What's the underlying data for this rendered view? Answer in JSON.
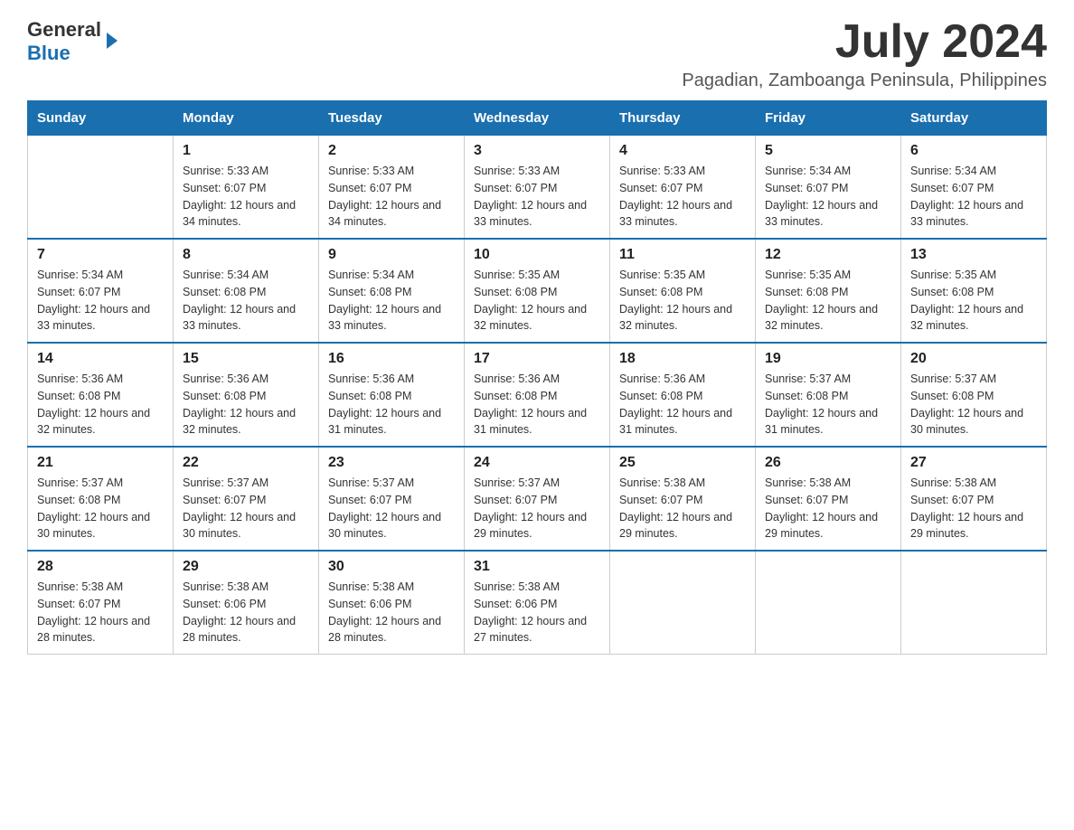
{
  "header": {
    "logo": {
      "text_general": "General",
      "text_blue": "Blue"
    },
    "title": "July 2024",
    "location": "Pagadian, Zamboanga Peninsula, Philippines"
  },
  "days_of_week": [
    "Sunday",
    "Monday",
    "Tuesday",
    "Wednesday",
    "Thursday",
    "Friday",
    "Saturday"
  ],
  "weeks": [
    [
      {
        "day": "",
        "sunrise": "",
        "sunset": "",
        "daylight": ""
      },
      {
        "day": "1",
        "sunrise": "Sunrise: 5:33 AM",
        "sunset": "Sunset: 6:07 PM",
        "daylight": "Daylight: 12 hours and 34 minutes."
      },
      {
        "day": "2",
        "sunrise": "Sunrise: 5:33 AM",
        "sunset": "Sunset: 6:07 PM",
        "daylight": "Daylight: 12 hours and 34 minutes."
      },
      {
        "day": "3",
        "sunrise": "Sunrise: 5:33 AM",
        "sunset": "Sunset: 6:07 PM",
        "daylight": "Daylight: 12 hours and 33 minutes."
      },
      {
        "day": "4",
        "sunrise": "Sunrise: 5:33 AM",
        "sunset": "Sunset: 6:07 PM",
        "daylight": "Daylight: 12 hours and 33 minutes."
      },
      {
        "day": "5",
        "sunrise": "Sunrise: 5:34 AM",
        "sunset": "Sunset: 6:07 PM",
        "daylight": "Daylight: 12 hours and 33 minutes."
      },
      {
        "day": "6",
        "sunrise": "Sunrise: 5:34 AM",
        "sunset": "Sunset: 6:07 PM",
        "daylight": "Daylight: 12 hours and 33 minutes."
      }
    ],
    [
      {
        "day": "7",
        "sunrise": "Sunrise: 5:34 AM",
        "sunset": "Sunset: 6:07 PM",
        "daylight": "Daylight: 12 hours and 33 minutes."
      },
      {
        "day": "8",
        "sunrise": "Sunrise: 5:34 AM",
        "sunset": "Sunset: 6:08 PM",
        "daylight": "Daylight: 12 hours and 33 minutes."
      },
      {
        "day": "9",
        "sunrise": "Sunrise: 5:34 AM",
        "sunset": "Sunset: 6:08 PM",
        "daylight": "Daylight: 12 hours and 33 minutes."
      },
      {
        "day": "10",
        "sunrise": "Sunrise: 5:35 AM",
        "sunset": "Sunset: 6:08 PM",
        "daylight": "Daylight: 12 hours and 32 minutes."
      },
      {
        "day": "11",
        "sunrise": "Sunrise: 5:35 AM",
        "sunset": "Sunset: 6:08 PM",
        "daylight": "Daylight: 12 hours and 32 minutes."
      },
      {
        "day": "12",
        "sunrise": "Sunrise: 5:35 AM",
        "sunset": "Sunset: 6:08 PM",
        "daylight": "Daylight: 12 hours and 32 minutes."
      },
      {
        "day": "13",
        "sunrise": "Sunrise: 5:35 AM",
        "sunset": "Sunset: 6:08 PM",
        "daylight": "Daylight: 12 hours and 32 minutes."
      }
    ],
    [
      {
        "day": "14",
        "sunrise": "Sunrise: 5:36 AM",
        "sunset": "Sunset: 6:08 PM",
        "daylight": "Daylight: 12 hours and 32 minutes."
      },
      {
        "day": "15",
        "sunrise": "Sunrise: 5:36 AM",
        "sunset": "Sunset: 6:08 PM",
        "daylight": "Daylight: 12 hours and 32 minutes."
      },
      {
        "day": "16",
        "sunrise": "Sunrise: 5:36 AM",
        "sunset": "Sunset: 6:08 PM",
        "daylight": "Daylight: 12 hours and 31 minutes."
      },
      {
        "day": "17",
        "sunrise": "Sunrise: 5:36 AM",
        "sunset": "Sunset: 6:08 PM",
        "daylight": "Daylight: 12 hours and 31 minutes."
      },
      {
        "day": "18",
        "sunrise": "Sunrise: 5:36 AM",
        "sunset": "Sunset: 6:08 PM",
        "daylight": "Daylight: 12 hours and 31 minutes."
      },
      {
        "day": "19",
        "sunrise": "Sunrise: 5:37 AM",
        "sunset": "Sunset: 6:08 PM",
        "daylight": "Daylight: 12 hours and 31 minutes."
      },
      {
        "day": "20",
        "sunrise": "Sunrise: 5:37 AM",
        "sunset": "Sunset: 6:08 PM",
        "daylight": "Daylight: 12 hours and 30 minutes."
      }
    ],
    [
      {
        "day": "21",
        "sunrise": "Sunrise: 5:37 AM",
        "sunset": "Sunset: 6:08 PM",
        "daylight": "Daylight: 12 hours and 30 minutes."
      },
      {
        "day": "22",
        "sunrise": "Sunrise: 5:37 AM",
        "sunset": "Sunset: 6:07 PM",
        "daylight": "Daylight: 12 hours and 30 minutes."
      },
      {
        "day": "23",
        "sunrise": "Sunrise: 5:37 AM",
        "sunset": "Sunset: 6:07 PM",
        "daylight": "Daylight: 12 hours and 30 minutes."
      },
      {
        "day": "24",
        "sunrise": "Sunrise: 5:37 AM",
        "sunset": "Sunset: 6:07 PM",
        "daylight": "Daylight: 12 hours and 29 minutes."
      },
      {
        "day": "25",
        "sunrise": "Sunrise: 5:38 AM",
        "sunset": "Sunset: 6:07 PM",
        "daylight": "Daylight: 12 hours and 29 minutes."
      },
      {
        "day": "26",
        "sunrise": "Sunrise: 5:38 AM",
        "sunset": "Sunset: 6:07 PM",
        "daylight": "Daylight: 12 hours and 29 minutes."
      },
      {
        "day": "27",
        "sunrise": "Sunrise: 5:38 AM",
        "sunset": "Sunset: 6:07 PM",
        "daylight": "Daylight: 12 hours and 29 minutes."
      }
    ],
    [
      {
        "day": "28",
        "sunrise": "Sunrise: 5:38 AM",
        "sunset": "Sunset: 6:07 PM",
        "daylight": "Daylight: 12 hours and 28 minutes."
      },
      {
        "day": "29",
        "sunrise": "Sunrise: 5:38 AM",
        "sunset": "Sunset: 6:06 PM",
        "daylight": "Daylight: 12 hours and 28 minutes."
      },
      {
        "day": "30",
        "sunrise": "Sunrise: 5:38 AM",
        "sunset": "Sunset: 6:06 PM",
        "daylight": "Daylight: 12 hours and 28 minutes."
      },
      {
        "day": "31",
        "sunrise": "Sunrise: 5:38 AM",
        "sunset": "Sunset: 6:06 PM",
        "daylight": "Daylight: 12 hours and 27 minutes."
      },
      {
        "day": "",
        "sunrise": "",
        "sunset": "",
        "daylight": ""
      },
      {
        "day": "",
        "sunrise": "",
        "sunset": "",
        "daylight": ""
      },
      {
        "day": "",
        "sunrise": "",
        "sunset": "",
        "daylight": ""
      }
    ]
  ]
}
